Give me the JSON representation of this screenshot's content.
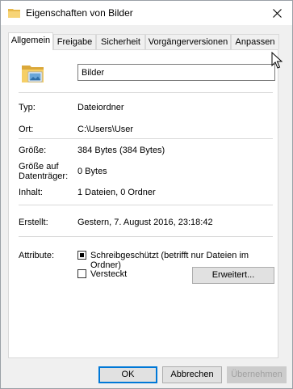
{
  "window": {
    "title": "Eigenschaften von Bilder"
  },
  "tabs": [
    {
      "label": "Allgemein"
    },
    {
      "label": "Freigabe"
    },
    {
      "label": "Sicherheit"
    },
    {
      "label": "Vorgängerversionen"
    },
    {
      "label": "Anpassen"
    }
  ],
  "general": {
    "name_value": "Bilder",
    "type_label": "Typ:",
    "type_value": "Dateiordner",
    "location_label": "Ort:",
    "location_value": "C:\\Users\\User",
    "size_label": "Größe:",
    "size_value": "384 Bytes (384 Bytes)",
    "size_on_disk_label_line1": "Größe auf",
    "size_on_disk_label_line2": "Datenträger:",
    "size_on_disk_value": "0 Bytes",
    "contents_label": "Inhalt:",
    "contents_value": "1 Dateien, 0 Ordner",
    "created_label": "Erstellt:",
    "created_value": "Gestern, 7. August 2016, 23:18:42",
    "attributes_label": "Attribute:",
    "readonly_label": "Schreibgeschützt (betrifft nur Dateien im Ordner)",
    "readonly_state": "indeterminate",
    "hidden_label": "Versteckt",
    "hidden_checked": false,
    "advanced_button": "Erweitert..."
  },
  "footer": {
    "ok": "OK",
    "cancel": "Abbrechen",
    "apply": "Übernehmen"
  },
  "icons": {
    "title": "folder-icon",
    "close": "close-icon",
    "folder_large": "folder-pictures-icon",
    "cursor": "mouse-cursor-icon"
  }
}
